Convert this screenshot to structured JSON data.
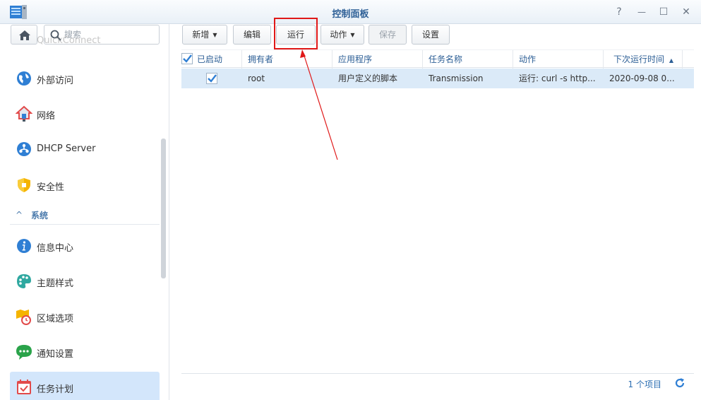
{
  "window": {
    "title": "控制面板",
    "help_glyph": "?",
    "minimize_glyph": "—",
    "maximize_glyph": "☐",
    "close_glyph": "✕"
  },
  "sidebar": {
    "search_placeholder": "搜索",
    "items": [
      {
        "label": "QuickConnect",
        "icon": "quickconnect-icon"
      },
      {
        "label": "外部访问",
        "icon": "globe-icon"
      },
      {
        "label": "网络",
        "icon": "network-house-icon"
      },
      {
        "label": "DHCP Server",
        "icon": "dhcp-icon"
      },
      {
        "label": "安全性",
        "icon": "shield-icon"
      },
      {
        "label": "信息中心",
        "icon": "info-icon"
      },
      {
        "label": "主题样式",
        "icon": "palette-icon"
      },
      {
        "label": "区域选项",
        "icon": "region-clock-icon"
      },
      {
        "label": "通知设置",
        "icon": "chat-bubble-icon"
      },
      {
        "label": "任务计划",
        "icon": "calendar-check-icon"
      }
    ],
    "section_system": "系统",
    "active_item": "任务计划"
  },
  "toolbar": {
    "create_label": "新增",
    "edit_label": "编辑",
    "run_label": "运行",
    "action_label": "动作",
    "save_label": "保存",
    "settings_label": "设置"
  },
  "grid": {
    "columns": [
      "已启动",
      "拥有者",
      "应用程序",
      "任务名称",
      "动作",
      "下次运行时间"
    ],
    "sort_glyph": "▲",
    "rows": [
      {
        "enabled": true,
        "owner": "root",
        "application": "用户定义的脚本",
        "task_name": "Transmission",
        "action": "运行: curl -s http...",
        "next_run": "2020-09-08 0..."
      }
    ]
  },
  "footer": {
    "count_label": "1 个项目"
  },
  "colors": {
    "accent": "#2d5f96",
    "selection": "#dbeaf8",
    "highlight_box": "#e01818"
  }
}
